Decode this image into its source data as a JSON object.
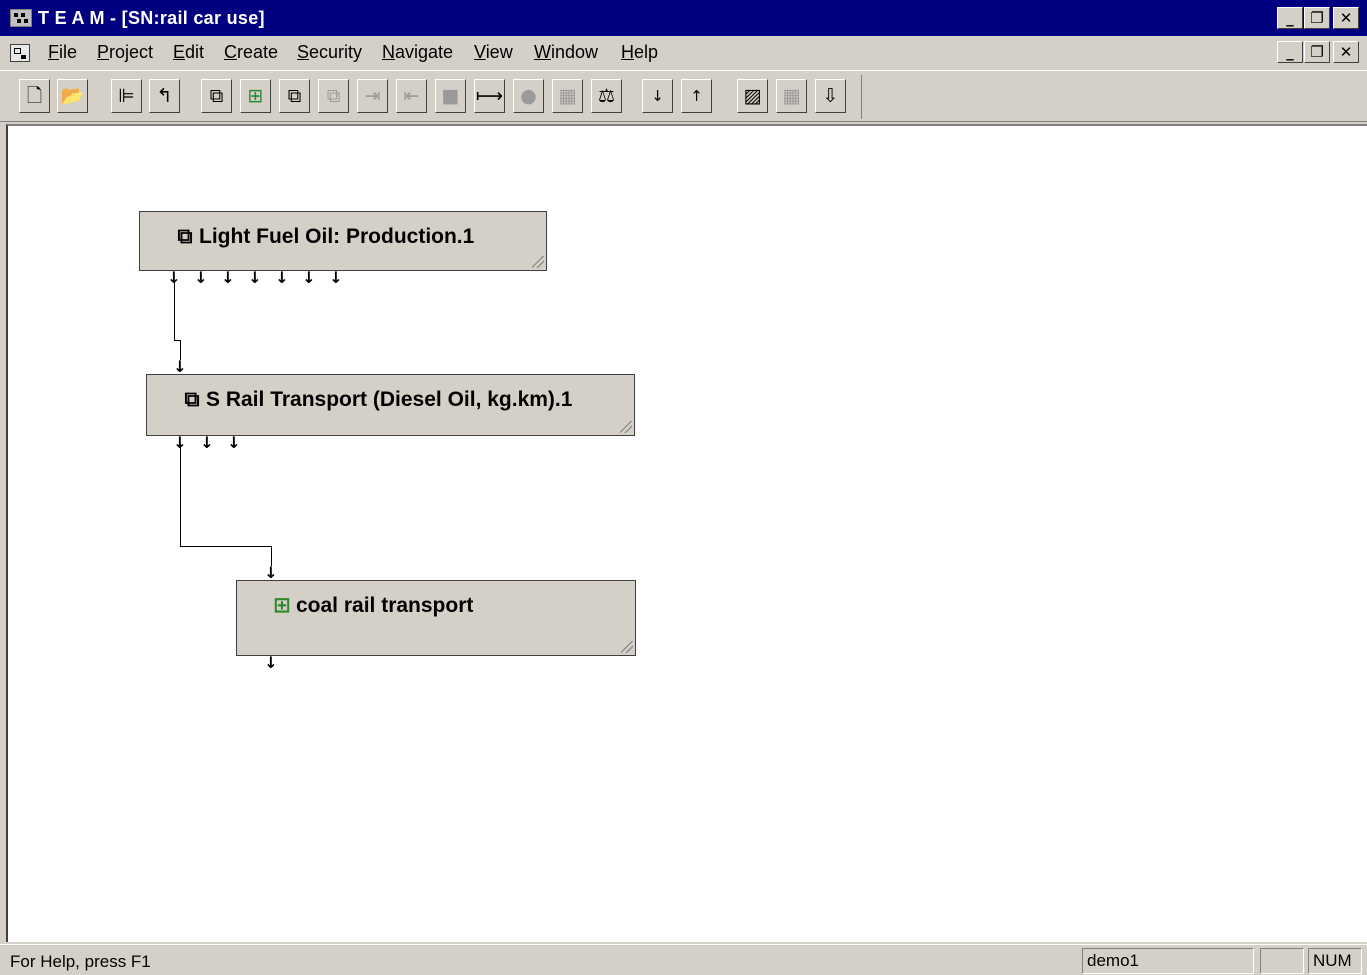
{
  "window": {
    "title": "T E A M - [SN:rail car use]"
  },
  "menu": {
    "items": [
      {
        "label": "File",
        "u": "F",
        "rest": "ile"
      },
      {
        "label": "Project",
        "u": "P",
        "rest": "roject"
      },
      {
        "label": "Edit",
        "u": "E",
        "rest": "dit"
      },
      {
        "label": "Create",
        "u": "C",
        "rest": "reate"
      },
      {
        "label": "Security",
        "u": "S",
        "rest": "ecurity"
      },
      {
        "label": "Navigate",
        "u": "N",
        "rest": "avigate"
      },
      {
        "label": "View",
        "u": "V",
        "rest": "iew"
      },
      {
        "label": "Window",
        "u": "W",
        "rest": "indow"
      },
      {
        "label": "Help",
        "u": "H",
        "rest": "elp"
      }
    ]
  },
  "toolbar": {
    "buttons": [
      {
        "name": "new-document",
        "glyph": "🗋",
        "enabled": true
      },
      {
        "name": "open-folder",
        "glyph": "📂",
        "enabled": true
      },
      {
        "name": "tree-view",
        "glyph": "⊫",
        "enabled": true
      },
      {
        "name": "go-up",
        "glyph": "↰",
        "enabled": true
      },
      {
        "name": "module-in",
        "glyph": "⧉",
        "enabled": true
      },
      {
        "name": "green-module",
        "glyph": "⊞",
        "enabled": true
      },
      {
        "name": "stacked-modules",
        "glyph": "⧉",
        "enabled": true
      },
      {
        "name": "stacked-modules-gray",
        "glyph": "⧉",
        "enabled": false
      },
      {
        "name": "arrow-to-bar",
        "glyph": "⇥",
        "enabled": false
      },
      {
        "name": "bar-to-arrow",
        "glyph": "⇤",
        "enabled": false
      },
      {
        "name": "gray-block",
        "glyph": "■",
        "enabled": false
      },
      {
        "name": "connect-span",
        "glyph": "⟼",
        "enabled": true
      },
      {
        "name": "gray-circle",
        "glyph": "●",
        "enabled": false
      },
      {
        "name": "gray-grid",
        "glyph": "▦",
        "enabled": false
      },
      {
        "name": "balance",
        "glyph": "⚖",
        "enabled": true
      },
      {
        "name": "lock-down",
        "glyph": "↓🔒",
        "enabled": true
      },
      {
        "name": "lock-up",
        "glyph": "↑🔒",
        "enabled": true
      },
      {
        "name": "chart",
        "glyph": "▨",
        "enabled": true
      },
      {
        "name": "table-grid",
        "glyph": "▦",
        "enabled": false
      },
      {
        "name": "arrow-down",
        "glyph": "⇩",
        "enabled": true
      }
    ]
  },
  "nodes": [
    {
      "id": "light-fuel-oil",
      "icon": "⧉",
      "icon_color": "#000000",
      "label": "Light Fuel Oil: Production.1"
    },
    {
      "id": "rail-transport",
      "icon": "⧉",
      "icon_color": "#000000",
      "label": "S Rail Transport (Diesel Oil, kg.km).1"
    },
    {
      "id": "coal-rail",
      "icon": "⊞",
      "icon_color": "#2c8a2c",
      "label": "coal rail transport"
    }
  ],
  "ports": {
    "arrow": "↓"
  },
  "statusbar": {
    "help": "For Help, press F1",
    "user": "demo1",
    "empty": "",
    "num": "NUM"
  }
}
